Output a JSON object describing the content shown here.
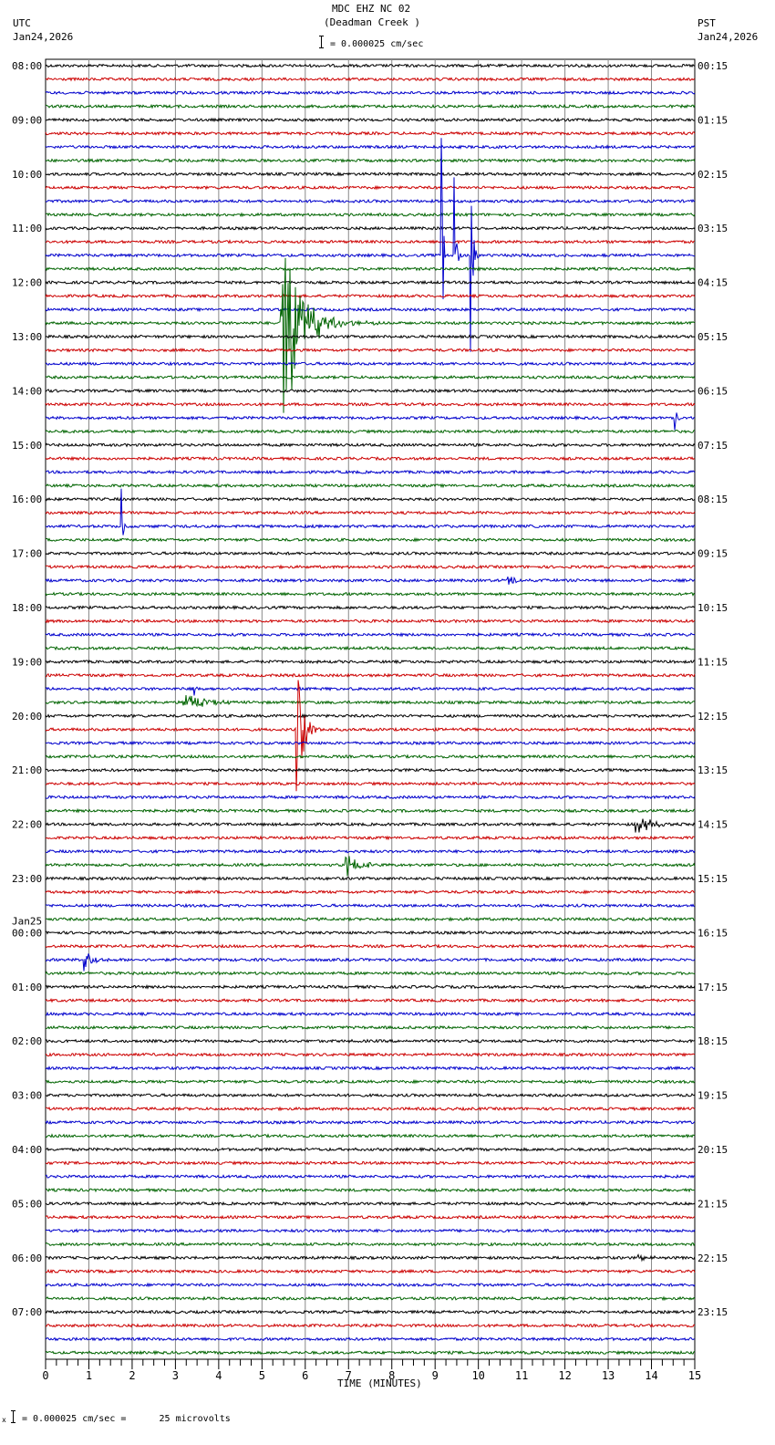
{
  "header": {
    "title": "MDC EHZ NC 02",
    "subtitle": "(Deadman Creek )",
    "scale_text": "= 0.000025 cm/sec",
    "left_tz": "UTC",
    "left_date": "Jan24,2026",
    "right_tz": "PST",
    "right_date": "Jan24,2026"
  },
  "footer": {
    "scale_text": "= 0.000025 cm/sec =      25 microvolts",
    "mark": "x"
  },
  "chart_data": {
    "type": "line",
    "subtype": "helicorder",
    "xlabel": "TIME (MINUTES)",
    "xlim": [
      0,
      15
    ],
    "x_ticks": [
      "0",
      "1",
      "2",
      "3",
      "4",
      "5",
      "6",
      "7",
      "8",
      "9",
      "10",
      "11",
      "12",
      "13",
      "14",
      "15"
    ],
    "grid": true,
    "trace_colors": [
      "#000000",
      "#cc0000",
      "#0000cc",
      "#006400"
    ],
    "traces_per_hour": 4,
    "trace_count": 96,
    "left_labels": [
      "08:00",
      "09:00",
      "10:00",
      "11:00",
      "12:00",
      "13:00",
      "14:00",
      "15:00",
      "16:00",
      "17:00",
      "18:00",
      "19:00",
      "20:00",
      "21:00",
      "22:00",
      "23:00",
      "00:00",
      "01:00",
      "02:00",
      "03:00",
      "04:00",
      "05:00",
      "06:00",
      "07:00"
    ],
    "left_date_change": {
      "hour_index": 16,
      "label": "Jan25"
    },
    "right_labels": [
      "00:15",
      "01:15",
      "02:15",
      "03:15",
      "04:15",
      "05:15",
      "06:15",
      "07:15",
      "08:15",
      "09:15",
      "10:15",
      "11:15",
      "12:15",
      "13:15",
      "14:15",
      "15:15",
      "16:15",
      "17:15",
      "18:15",
      "19:15",
      "20:15",
      "21:15",
      "22:15",
      "23:15"
    ],
    "noise_level": 0.1,
    "events": [
      {
        "trace": 19,
        "minute": 5.45,
        "amplitude": 9,
        "decay_min": 0.35
      },
      {
        "trace": 19,
        "minute": 5.5,
        "amplitude": 1.3,
        "decay_min": 0.7
      },
      {
        "trace": 14,
        "minute": 9.15,
        "amplitude": 9,
        "decay_min": 0.04
      },
      {
        "trace": 14,
        "minute": 9.45,
        "amplitude": 9,
        "decay_min": 0.03
      },
      {
        "trace": 14,
        "minute": 9.82,
        "amplitude": 10,
        "decay_min": 0.04
      },
      {
        "trace": 26,
        "minute": 14.55,
        "amplitude": 1,
        "decay_min": 0.04
      },
      {
        "trace": 38,
        "minute": 10.7,
        "amplitude": 0.5,
        "decay_min": 0.15
      },
      {
        "trace": 34,
        "minute": 1.75,
        "amplitude": 9,
        "decay_min": 0.02
      },
      {
        "trace": 46,
        "minute": 3.4,
        "amplitude": 2,
        "decay_min": 0.03
      },
      {
        "trace": 47,
        "minute": 3.2,
        "amplitude": 0.8,
        "decay_min": 0.4
      },
      {
        "trace": 49,
        "minute": 5.8,
        "amplitude": 5,
        "decay_min": 0.15
      },
      {
        "trace": 56,
        "minute": 13.65,
        "amplitude": 0.8,
        "decay_min": 0.3
      },
      {
        "trace": 59,
        "minute": 6.95,
        "amplitude": 0.8,
        "decay_min": 0.3
      },
      {
        "trace": 66,
        "minute": 0.9,
        "amplitude": 1.2,
        "decay_min": 0.15
      },
      {
        "trace": 88,
        "minute": 13.7,
        "amplitude": 0.3,
        "decay_min": 0.2
      }
    ]
  }
}
